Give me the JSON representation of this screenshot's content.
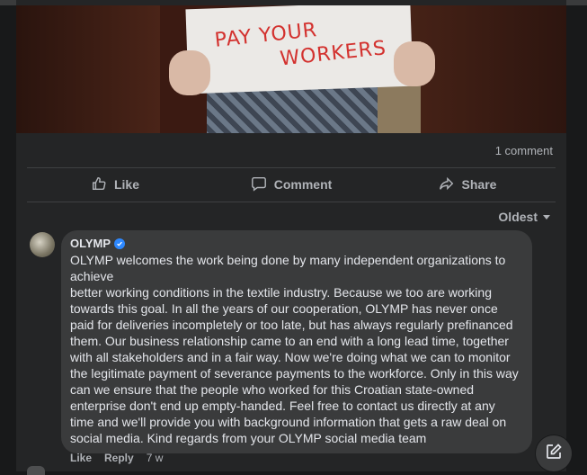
{
  "post": {
    "image_sign_line1": "PAY YOUR",
    "image_sign_line2": "WORKERS",
    "comment_count": "1 comment"
  },
  "actions": {
    "like": "Like",
    "comment": "Comment",
    "share": "Share"
  },
  "sort": {
    "label": "Oldest"
  },
  "comment": {
    "author": "OLYMP",
    "text": "OLYMP welcomes the work being done by many independent organizations to achieve\nbetter working conditions in the textile industry. Because we too are working towards this goal. In all the years of our cooperation, OLYMP has never once paid for deliveries incompletely or too late, but has always regularly prefinanced them. Our business relationship came to an end with a long lead time, together with all stakeholders and in a fair way. Now we're doing what we can to monitor the legitimate payment of severance payments to the workforce. Only in this way can we ensure that the people who worked for this Croatian state-owned enterprise don't end up empty-handed. Feel free to contact us directly at any time and we'll provide you with background information that gets a raw deal on social media. Kind regards from your OLYMP social media team",
    "like_label": "Like",
    "reply_label": "Reply",
    "time": "7 w"
  },
  "colors": {
    "background": "#18191a",
    "card": "#242526",
    "bubble": "#3a3b3c",
    "text": "#e4e6eb",
    "secondary": "#b0b3b8",
    "verified": "#2d88ff"
  },
  "icons": {
    "like": "thumbs-up-icon",
    "comment": "speech-bubble-icon",
    "share": "share-arrow-icon",
    "sort": "caret-down-icon",
    "verified": "verified-badge-icon",
    "edit": "compose-icon"
  }
}
